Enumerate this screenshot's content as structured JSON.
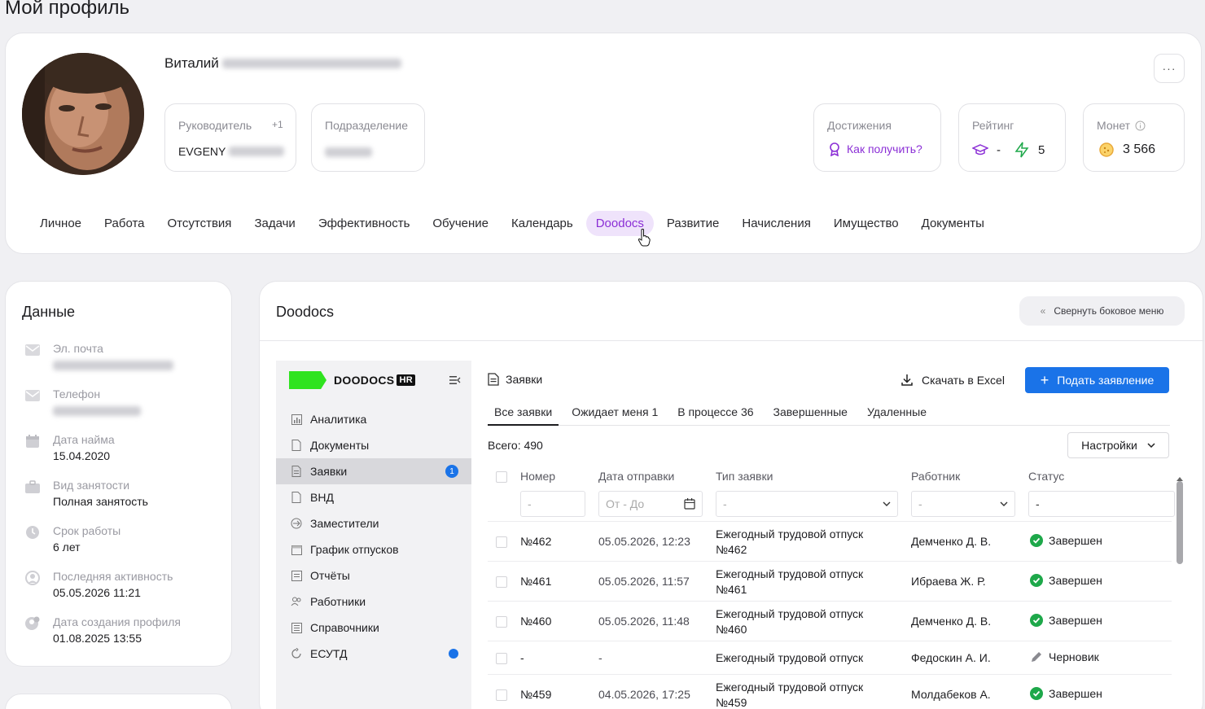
{
  "page": {
    "title": "Мой профиль"
  },
  "profile": {
    "first_name": "Виталий",
    "more_label": "···",
    "manager": {
      "label": "Руководитель",
      "extra": "+1",
      "value": "EVGENY"
    },
    "department": {
      "label": "Подразделение"
    },
    "achievements": {
      "label": "Достижения",
      "link": "Как получить?"
    },
    "rating": {
      "label": "Рейтинг",
      "value1": "-",
      "value2": "5"
    },
    "coins": {
      "label": "Монет",
      "value": "3 566"
    }
  },
  "tabs": [
    "Личное",
    "Работа",
    "Отсутствия",
    "Задачи",
    "Эффективность",
    "Обучение",
    "Календарь",
    "Doodocs",
    "Развитие",
    "Начисления",
    "Имущество",
    "Документы"
  ],
  "data_panel": {
    "title": "Данные",
    "items": [
      {
        "label": "Эл. почта",
        "value": "",
        "icon": "mail-icon"
      },
      {
        "label": "Телефон",
        "value": "",
        "icon": "phone-icon"
      },
      {
        "label": "Дата найма",
        "value": "15.04.2020",
        "icon": "calendar-icon"
      },
      {
        "label": "Вид занятости",
        "value": "Полная занятость",
        "icon": "briefcase-icon"
      },
      {
        "label": "Срок работы",
        "value": "6 лет",
        "icon": "clock-icon"
      },
      {
        "label": "Последняя активность",
        "value": "05.05.2026 11:21",
        "icon": "activity-icon"
      },
      {
        "label": "Дата создания профиля",
        "value": "01.08.2025 13:55",
        "icon": "user-add-icon"
      }
    ]
  },
  "doodocs": {
    "title": "Doodocs",
    "collapse_label": "Свернуть боковое меню",
    "logo_text": "DOODOCS",
    "logo_badge": "HR",
    "sidebar": [
      {
        "label": "Аналитика",
        "icon": "analytics-icon"
      },
      {
        "label": "Документы",
        "icon": "document-icon"
      },
      {
        "label": "Заявки",
        "icon": "requests-icon",
        "badge": "1"
      },
      {
        "label": "ВНД",
        "icon": "vnd-icon"
      },
      {
        "label": "Заместители",
        "icon": "deputies-icon"
      },
      {
        "label": "График отпусков",
        "icon": "vacation-schedule-icon"
      },
      {
        "label": "Отчёты",
        "icon": "reports-icon"
      },
      {
        "label": "Работники",
        "icon": "employees-icon"
      },
      {
        "label": "Справочники",
        "icon": "directories-icon"
      },
      {
        "label": "ЕСУТД",
        "icon": "esutd-icon"
      }
    ],
    "content_title": "Заявки",
    "excel_label": "Скачать в Excel",
    "apply_label": "Подать заявление",
    "tabs": [
      "Все заявки",
      "Ожидает меня 1",
      "В процессе 36",
      "Завершенные",
      "Удаленные"
    ],
    "total": "Всего: 490",
    "settings_label": "Настройки",
    "columns": [
      "Номер",
      "Дата отправки",
      "Тип заявки",
      "Работник",
      "Статус"
    ],
    "filters": {
      "number": "-",
      "date": "От - До",
      "type": "-",
      "worker": "-",
      "status": "-"
    },
    "rows": [
      {
        "number": "№462",
        "date": "05.05.2026, 12:23",
        "type1": "Ежегодный трудовой отпуск",
        "type2": "№462",
        "worker": "Демченко Д. В.",
        "status": "Завершен",
        "kind": "done"
      },
      {
        "number": "№461",
        "date": "05.05.2026, 11:57",
        "type1": "Ежегодный трудовой отпуск",
        "type2": "№461",
        "worker": "Ибраева Ж. Р.",
        "status": "Завершен",
        "kind": "done"
      },
      {
        "number": "№460",
        "date": "05.05.2026, 11:48",
        "type1": "Ежегодный трудовой отпуск",
        "type2": "№460",
        "worker": "Демченко Д. В.",
        "status": "Завершен",
        "kind": "done"
      },
      {
        "number": "-",
        "date": "-",
        "type1": "Ежегодный трудовой отпуск",
        "type2": "",
        "worker": "Федоскин А. И.",
        "status": "Черновик",
        "kind": "draft"
      },
      {
        "number": "№459",
        "date": "04.05.2026, 17:25",
        "type1": "Ежегодный трудовой отпуск",
        "type2": "№459",
        "worker": "Молдабеков А.",
        "status": "Завершен",
        "kind": "done"
      }
    ]
  },
  "colors": {
    "accent": "#1a73e8",
    "active_tab_bg": "#efe3fb",
    "active_tab_text": "#8b2fd6",
    "success": "#1ea84a",
    "logo_green": "#2fe31f"
  }
}
